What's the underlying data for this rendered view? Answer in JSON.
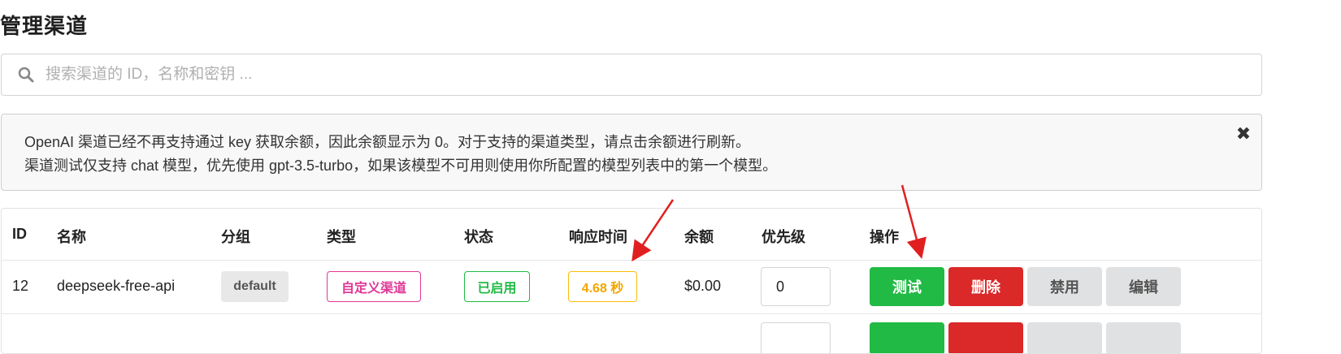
{
  "page": {
    "title": "管理渠道"
  },
  "search": {
    "placeholder": "搜索渠道的 ID，名称和密钥 ..."
  },
  "notice": {
    "line1": "OpenAI 渠道已经不再支持通过 key 获取余额，因此余额显示为 0。对于支持的渠道类型，请点击余额进行刷新。",
    "line2": "渠道测试仅支持 chat 模型，优先使用 gpt-3.5-turbo，如果该模型不可用则使用你所配置的模型列表中的第一个模型。"
  },
  "table": {
    "headers": [
      "ID",
      "名称",
      "分组",
      "类型",
      "状态",
      "响应时间",
      "余额",
      "优先级",
      "操作"
    ],
    "rows": [
      {
        "id": "12",
        "name": "deepseek-free-api",
        "group": "default",
        "type": "自定义渠道",
        "status": "已启用",
        "response_time": "4.68 秒",
        "balance": "$0.00",
        "priority": "0",
        "actions": {
          "test": "测试",
          "delete": "删除",
          "disable": "禁用",
          "edit": "编辑"
        }
      }
    ]
  },
  "colors": {
    "test": "#21ba45",
    "delete": "#db2828",
    "type_label": "#e03997",
    "status_label": "#21ba45",
    "response_label": "#fbbd08",
    "annotation_arrow": "#e02020"
  },
  "icons": {
    "search": "search-icon",
    "close": "close-icon"
  }
}
